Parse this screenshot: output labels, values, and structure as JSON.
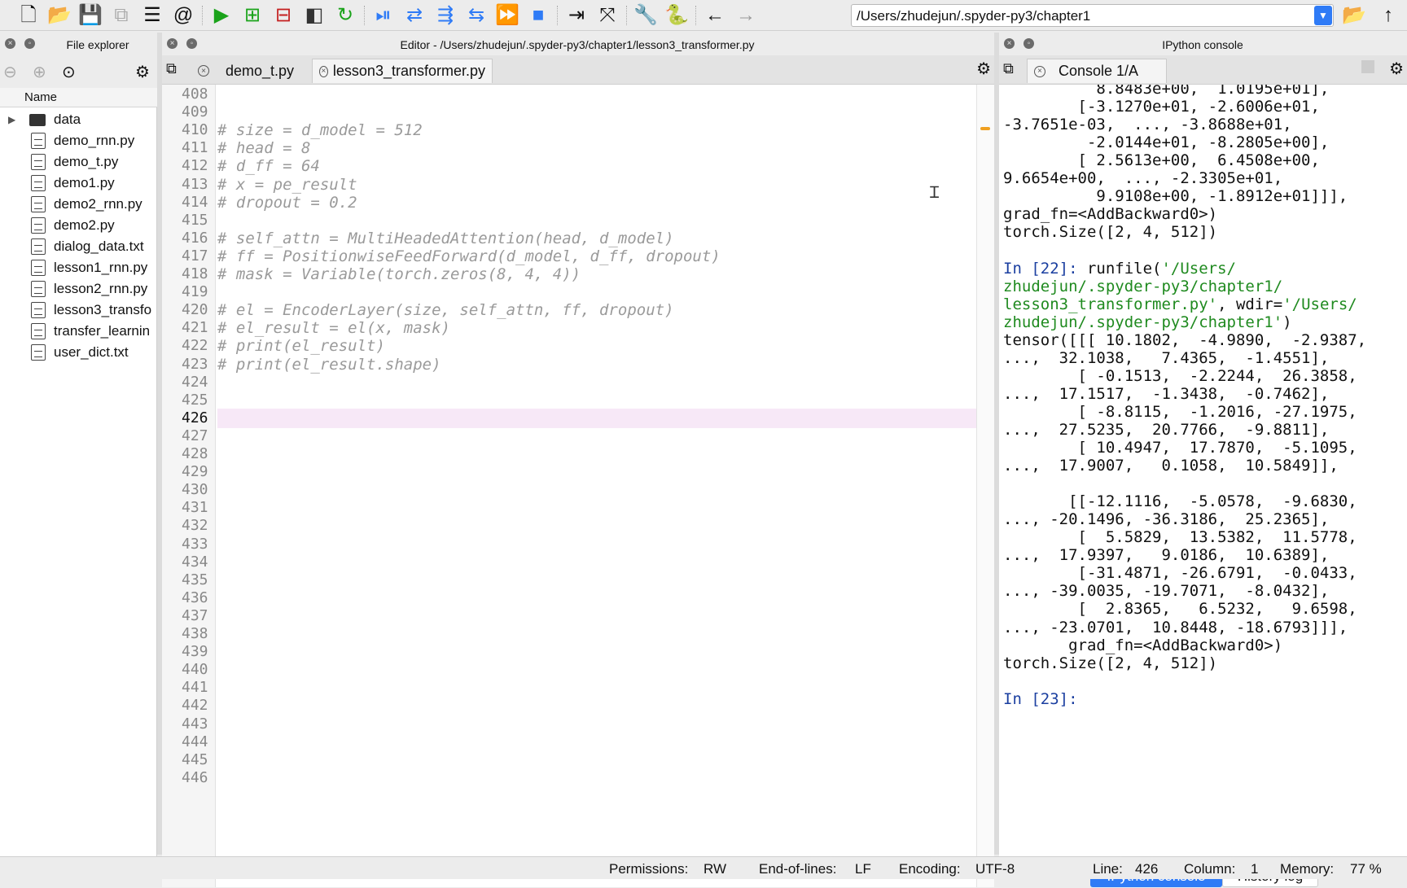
{
  "toolbar": {
    "path": "/Users/zhudejun/.spyder-py3/chapter1",
    "buttons": [
      "new-file-icon",
      "open-file-icon",
      "save-icon",
      "save-all-icon",
      "list-icon",
      "at-icon",
      "run-icon",
      "run-cell-icon",
      "run-cell-advance-icon",
      "run-selection-icon",
      "rerun-icon",
      "debug-icon",
      "step-icon",
      "step-into-icon",
      "step-return-icon",
      "continue-icon",
      "stop-icon",
      "maximize-pane-icon",
      "fullscreen-icon",
      "wrench-icon",
      "python-icon",
      "back-arrow-icon",
      "forward-arrow-icon"
    ]
  },
  "file_explorer": {
    "title": "File explorer",
    "column_header": "Name",
    "items": [
      {
        "label": "data",
        "type": "folder"
      },
      {
        "label": "demo_rnn.py",
        "type": "file"
      },
      {
        "label": "demo_t.py",
        "type": "file"
      },
      {
        "label": "demo1.py",
        "type": "file"
      },
      {
        "label": "demo2_rnn.py",
        "type": "file"
      },
      {
        "label": "demo2.py",
        "type": "file"
      },
      {
        "label": "dialog_data.txt",
        "type": "file"
      },
      {
        "label": "lesson1_rnn.py",
        "type": "file"
      },
      {
        "label": "lesson2_rnn.py",
        "type": "file"
      },
      {
        "label": "lesson3_transfo",
        "type": "file"
      },
      {
        "label": "transfer_learnin",
        "type": "file"
      },
      {
        "label": "user_dict.txt",
        "type": "file"
      }
    ]
  },
  "editor": {
    "title": "Editor - /Users/zhudejun/.spyder-py3/chapter1/lesson3_transformer.py",
    "tabs": [
      {
        "label": "demo_t.py"
      },
      {
        "label": "lesson3_transformer.py"
      }
    ],
    "current_line": "426",
    "lines": [
      {
        "n": "408",
        "code": ""
      },
      {
        "n": "409",
        "code": ""
      },
      {
        "n": "410",
        "code": "# size = d_model = 512"
      },
      {
        "n": "411",
        "code": "# head = 8"
      },
      {
        "n": "412",
        "code": "# d_ff = 64"
      },
      {
        "n": "413",
        "code": "# x = pe_result"
      },
      {
        "n": "414",
        "code": "# dropout = 0.2"
      },
      {
        "n": "415",
        "code": ""
      },
      {
        "n": "416",
        "code": "# self_attn = MultiHeadedAttention(head, d_model)"
      },
      {
        "n": "417",
        "code": "# ff = PositionwiseFeedForward(d_model, d_ff, dropout)"
      },
      {
        "n": "418",
        "code": "# mask = Variable(torch.zeros(8, 4, 4))"
      },
      {
        "n": "419",
        "code": ""
      },
      {
        "n": "420",
        "code": "# el = EncoderLayer(size, self_attn, ff, dropout)"
      },
      {
        "n": "421",
        "code": "# el_result = el(x, mask)"
      },
      {
        "n": "422",
        "code": "# print(el_result)"
      },
      {
        "n": "423",
        "code": "# print(el_result.shape)"
      },
      {
        "n": "424",
        "code": ""
      },
      {
        "n": "425",
        "code": ""
      },
      {
        "n": "426",
        "code": ""
      },
      {
        "n": "427",
        "code": ""
      },
      {
        "n": "428",
        "code": ""
      },
      {
        "n": "429",
        "code": ""
      },
      {
        "n": "430",
        "code": ""
      },
      {
        "n": "431",
        "code": ""
      },
      {
        "n": "432",
        "code": ""
      },
      {
        "n": "433",
        "code": ""
      },
      {
        "n": "434",
        "code": ""
      },
      {
        "n": "435",
        "code": ""
      },
      {
        "n": "436",
        "code": ""
      },
      {
        "n": "437",
        "code": ""
      },
      {
        "n": "438",
        "code": ""
      },
      {
        "n": "439",
        "code": ""
      },
      {
        "n": "440",
        "code": ""
      },
      {
        "n": "441",
        "code": ""
      },
      {
        "n": "442",
        "code": ""
      },
      {
        "n": "443",
        "code": ""
      },
      {
        "n": "444",
        "code": ""
      },
      {
        "n": "445",
        "code": ""
      },
      {
        "n": "446",
        "code": ""
      }
    ]
  },
  "console": {
    "title": "IPython console",
    "tab_label": "Console 1/A",
    "lines": [
      {
        "text": "          8.8483e+00,  1.0195e+01],"
      },
      {
        "text": "        [-3.1270e+01, -2.6006e+01,"
      },
      {
        "text": "-3.7651e-03,  ..., -3.8688e+01,"
      },
      {
        "text": "         -2.0144e+01, -8.2805e+00],"
      },
      {
        "text": "        [ 2.5613e+00,  6.4508e+00,"
      },
      {
        "text": "9.6654e+00,  ..., -2.3305e+01,"
      },
      {
        "text": "          9.9108e+00, -1.8912e+01]]],"
      },
      {
        "text": "grad_fn=<AddBackward0>)"
      },
      {
        "text": "torch.Size([2, 4, 512])"
      },
      {
        "text": ""
      },
      {
        "prompt": "In [22]: ",
        "text": "runfile(",
        "str": "'/Users/"
      },
      {
        "str": "zhudejun/.spyder-py3/chapter1/"
      },
      {
        "str": "lesson3_transformer.py'",
        "text": ", wdir=",
        "str2": "'/Users/"
      },
      {
        "str": "zhudejun/.spyder-py3/chapter1'",
        "text": ")"
      },
      {
        "text": "tensor([[[ 10.1802,  -4.9890,  -2.9387,"
      },
      {
        "text": "...,  32.1038,   7.4365,  -1.4551],"
      },
      {
        "text": "        [ -0.1513,  -2.2244,  26.3858,"
      },
      {
        "text": "...,  17.1517,  -1.3438,  -0.7462],"
      },
      {
        "text": "        [ -8.8115,  -1.2016, -27.1975,"
      },
      {
        "text": "...,  27.5235,  20.7766,  -9.8811],"
      },
      {
        "text": "        [ 10.4947,  17.7870,  -5.1095,"
      },
      {
        "text": "...,  17.9007,   0.1058,  10.5849]],"
      },
      {
        "text": ""
      },
      {
        "text": "       [[-12.1116,  -5.0578,  -9.6830,"
      },
      {
        "text": "..., -20.1496, -36.3186,  25.2365],"
      },
      {
        "text": "        [  5.5829,  13.5382,  11.5778,"
      },
      {
        "text": "...,  17.9397,   9.0186,  10.6389],"
      },
      {
        "text": "        [-31.4871, -26.6791,  -0.0433,"
      },
      {
        "text": "..., -39.0035, -19.7071,  -8.0432],"
      },
      {
        "text": "        [  2.8365,   6.5232,   9.6598,"
      },
      {
        "text": "..., -23.0701,  10.8448, -18.6793]]],"
      },
      {
        "text": "       grad_fn=<AddBackward0>)"
      },
      {
        "text": "torch.Size([2, 4, 512])"
      },
      {
        "text": ""
      },
      {
        "prompt": "In [23]: "
      }
    ],
    "bottom_tabs": [
      "IPython console",
      "History log"
    ]
  },
  "status": {
    "permissions_label": "Permissions:",
    "permissions_value": "RW",
    "eol_label": "End-of-lines:",
    "eol_value": "LF",
    "encoding_label": "Encoding:",
    "encoding_value": "UTF-8",
    "line_label": "Line:",
    "line_value": "426",
    "column_label": "Column:",
    "column_value": "1",
    "memory_label": "Memory:",
    "memory_value": "77 %"
  },
  "colors": {
    "accent": "#2f7bf6",
    "current_line": "#f7e8f7",
    "prompt": "#1b3fa0",
    "string": "#1f8a1f",
    "comment": "#9a9a9a"
  }
}
